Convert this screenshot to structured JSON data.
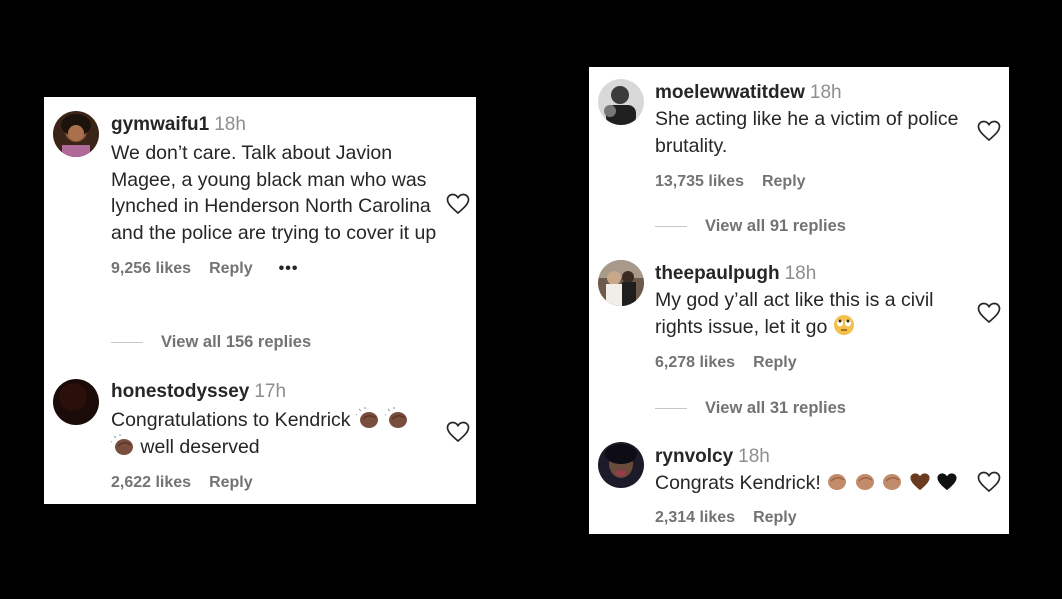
{
  "left_panel": {
    "comments": [
      {
        "username": "gymwaifu1",
        "time": "18h",
        "text": "We don’t care. Talk about Javion Magee, a young black man who was lynched in Henderson North Carolina and the police are trying to cover it up",
        "likes": "9,256 likes",
        "reply": "Reply",
        "more": "•••",
        "view_replies": "View all 156 replies"
      },
      {
        "username": "honestodyssey",
        "time": "17h",
        "text_before": "Congratulations to Kendrick",
        "text_after": "well deserved",
        "likes": "2,622 likes",
        "reply": "Reply",
        "emoji": [
          "clapping-hands-medium-dark",
          "clapping-hands-medium-dark",
          "clapping-hands-medium-dark"
        ]
      }
    ]
  },
  "right_panel": {
    "comments": [
      {
        "username": "moelewwatitdew",
        "time": "18h",
        "text": "She acting like he a victim of police brutality.",
        "likes": "13,735 likes",
        "reply": "Reply",
        "view_replies": "View all 91 replies"
      },
      {
        "username": "theepaulpugh",
        "time": "18h",
        "text": "My god y’all act like this is a civil rights issue, let it go",
        "likes": "6,278 likes",
        "reply": "Reply",
        "emoji": [
          "face-with-rolling-eyes"
        ],
        "view_replies": "View all 31 replies"
      },
      {
        "username": "rynvolcy",
        "time": "18h",
        "text": "Congrats Kendrick!",
        "likes": "2,314 likes",
        "reply": "Reply",
        "emoji": [
          "clapping-hands-medium",
          "clapping-hands-medium",
          "clapping-hands-medium",
          "brown-heart",
          "black-heart"
        ]
      }
    ]
  },
  "colors": {
    "background": "#000000",
    "panel": "#ffffff",
    "text": "#262626",
    "muted": "#737373",
    "clap_dark": "#7a4e3c",
    "clap_medium": "#c28b6a",
    "brown_heart": "#6b3b1f",
    "black_heart": "#111111"
  }
}
